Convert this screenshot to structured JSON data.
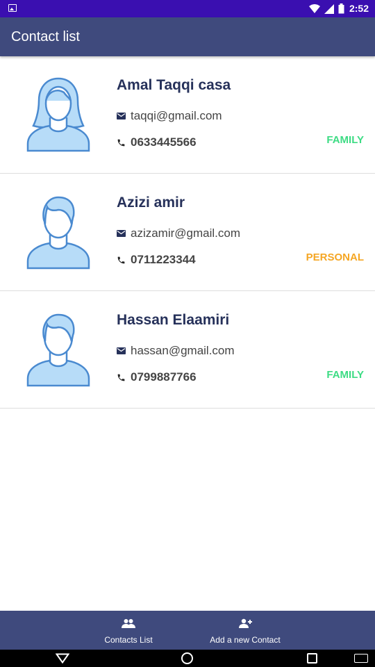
{
  "status_bar": {
    "time": "2:52"
  },
  "app_bar": {
    "title": "Contact list"
  },
  "contacts": [
    {
      "name": "Amal Taqqi casa",
      "email": "taqqi@gmail.com",
      "phone": "0633445566",
      "category": "FAMILY",
      "category_color": "#3ddc84",
      "avatar": "female-avatar-icon"
    },
    {
      "name": "Azizi amir",
      "email": "azizamir@gmail.com",
      "phone": "0711223344",
      "category": "PERSONAL",
      "category_color": "#f5a623",
      "avatar": "male-avatar-icon"
    },
    {
      "name": "Hassan Elaamiri",
      "email": "hassan@gmail.com",
      "phone": "0799887766",
      "category": "FAMILY",
      "category_color": "#3ddc84",
      "avatar": "male-avatar-icon"
    }
  ],
  "bottom_nav": {
    "items": [
      {
        "label": "Contacts List",
        "icon": "people-icon"
      },
      {
        "label": "Add a new Contact",
        "icon": "add-person-icon"
      }
    ]
  },
  "colors": {
    "primary": "#3f4a7d",
    "status_bar": "#3a0fb0",
    "name_text": "#26315a",
    "avatar_fill": "#b7dcf8",
    "avatar_stroke": "#4a8ad0"
  }
}
